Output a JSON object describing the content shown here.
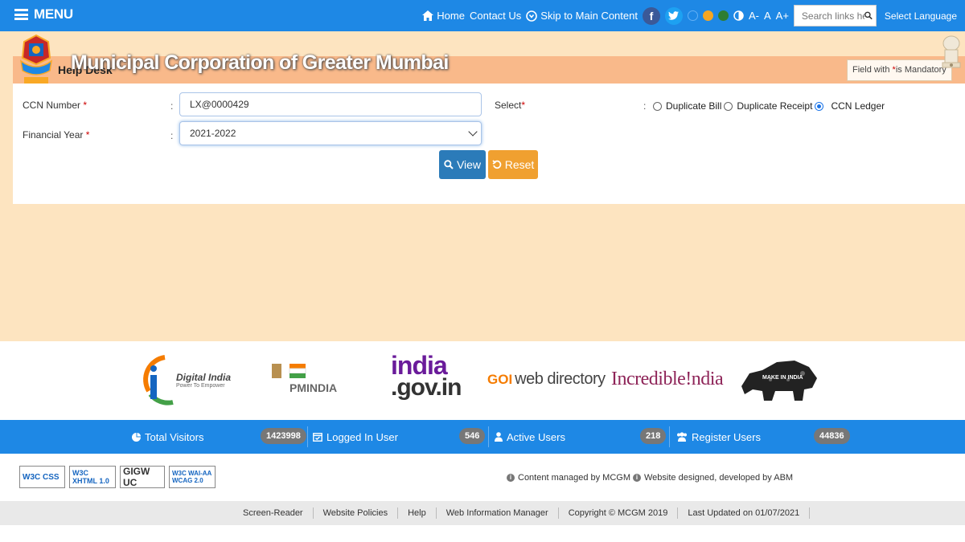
{
  "topbar": {
    "menu_label": "MENU",
    "home": "Home",
    "contact": "Contact Us",
    "skip": "Skip to Main Content",
    "facebook_glyph": "f",
    "font_minus": "A-",
    "font_normal": "A",
    "font_plus": "A+",
    "search_placeholder": "Search links here",
    "language": "Select Language",
    "theme_colors": [
      "#1e88e5",
      "#f5a623",
      "#2e7d32"
    ],
    "accent": "#1e88e5"
  },
  "header": {
    "title": "Municipal Corporation of Greater Mumbai",
    "page_heading": "Help Desk",
    "mandatory_note_prefix": "Field with ",
    "mandatory_star": "*",
    "mandatory_note_suffix": "is Mandatory"
  },
  "form": {
    "ccn_label": "CCN Number",
    "ccn_value": "LX@0000429",
    "financial_year_label": "Financial Year",
    "financial_year_value": "2021-2022",
    "select_label": "Select",
    "required_star": "*",
    "colon": ":",
    "options": [
      "Duplicate Bill",
      "Duplicate Receipt",
      "CCN Ledger"
    ],
    "selected_option": "CCN Ledger",
    "view_button": "View",
    "reset_button": "Reset"
  },
  "partners": {
    "digital_india": "Digital India",
    "digital_india_tag": "Power To Empower",
    "pmindia": "PMINDIA",
    "india_gov": "india",
    "india_gov_suffix": ".gov.in",
    "goi": "GOI",
    "goi_rest": "web directory",
    "incredible": "Incredible!ndia",
    "make_in_india": "MAKE IN INDIA"
  },
  "stats": {
    "total_visitors_label": "Total Visitors",
    "total_visitors": "1423998",
    "logged_in_label": "Logged In User",
    "logged_in": "546",
    "active_users_label": "Active Users",
    "active_users": "218",
    "register_users_label": "Register Users",
    "register_users": "44836"
  },
  "footer": {
    "badges": [
      "W3C CSS",
      "W3C XHTML 1.0",
      "GIGW UC",
      "W3C WAI-AA WCAG 2.0"
    ],
    "content_managed": "Content managed by MCGM",
    "designed_by": "Website designed, developed by ABM",
    "links": [
      "Screen-Reader",
      "Website Policies",
      "Help",
      "Web Information Manager",
      "Copyright © MCGM 2019",
      "Last Updated on  01/07/2021"
    ]
  }
}
